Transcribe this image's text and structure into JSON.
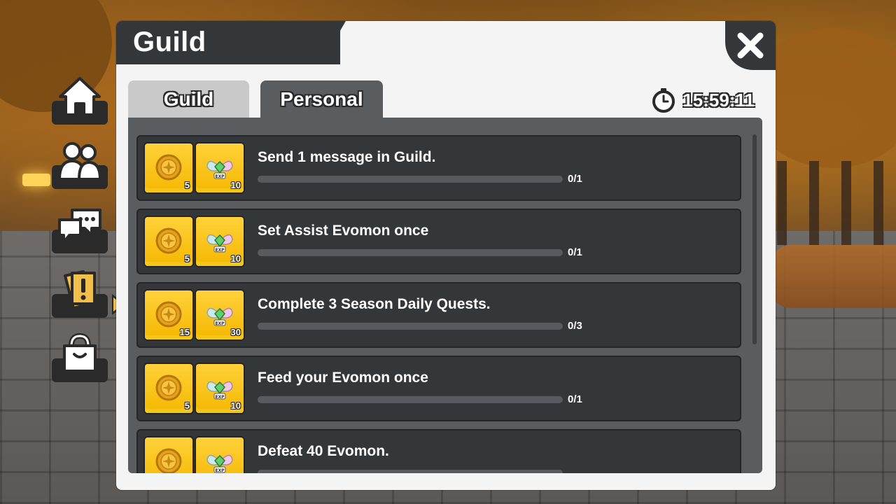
{
  "panel": {
    "title": "Guild"
  },
  "tabs": [
    {
      "label": "Guild",
      "active": false
    },
    {
      "label": "Personal",
      "active": true
    }
  ],
  "timer": {
    "value": "15:59:11"
  },
  "sidebar": {
    "items": [
      {
        "icon": "home-icon"
      },
      {
        "icon": "friends-icon"
      },
      {
        "icon": "chat-icon"
      },
      {
        "icon": "quest-icon",
        "selected": true
      },
      {
        "icon": "bag-icon"
      }
    ]
  },
  "quests": [
    {
      "title": "Send 1 message in Guild.",
      "coin": "5",
      "exp": "10",
      "progress": "0/1",
      "fraction": 0
    },
    {
      "title": "Set Assist Evomon once",
      "coin": "5",
      "exp": "10",
      "progress": "0/1",
      "fraction": 0
    },
    {
      "title": "Complete 3 Season Daily Quests.",
      "coin": "15",
      "exp": "30",
      "progress": "0/3",
      "fraction": 0
    },
    {
      "title": "Feed your Evomon once",
      "coin": "5",
      "exp": "10",
      "progress": "0/1",
      "fraction": 0
    },
    {
      "title": "Defeat 40 Evomon.",
      "coin": "",
      "exp": "",
      "progress": "",
      "fraction": 0
    }
  ],
  "colors": {
    "panel_dark": "#34373a",
    "reward_gold": "#ffd13a",
    "accent": "#f2c04a"
  }
}
